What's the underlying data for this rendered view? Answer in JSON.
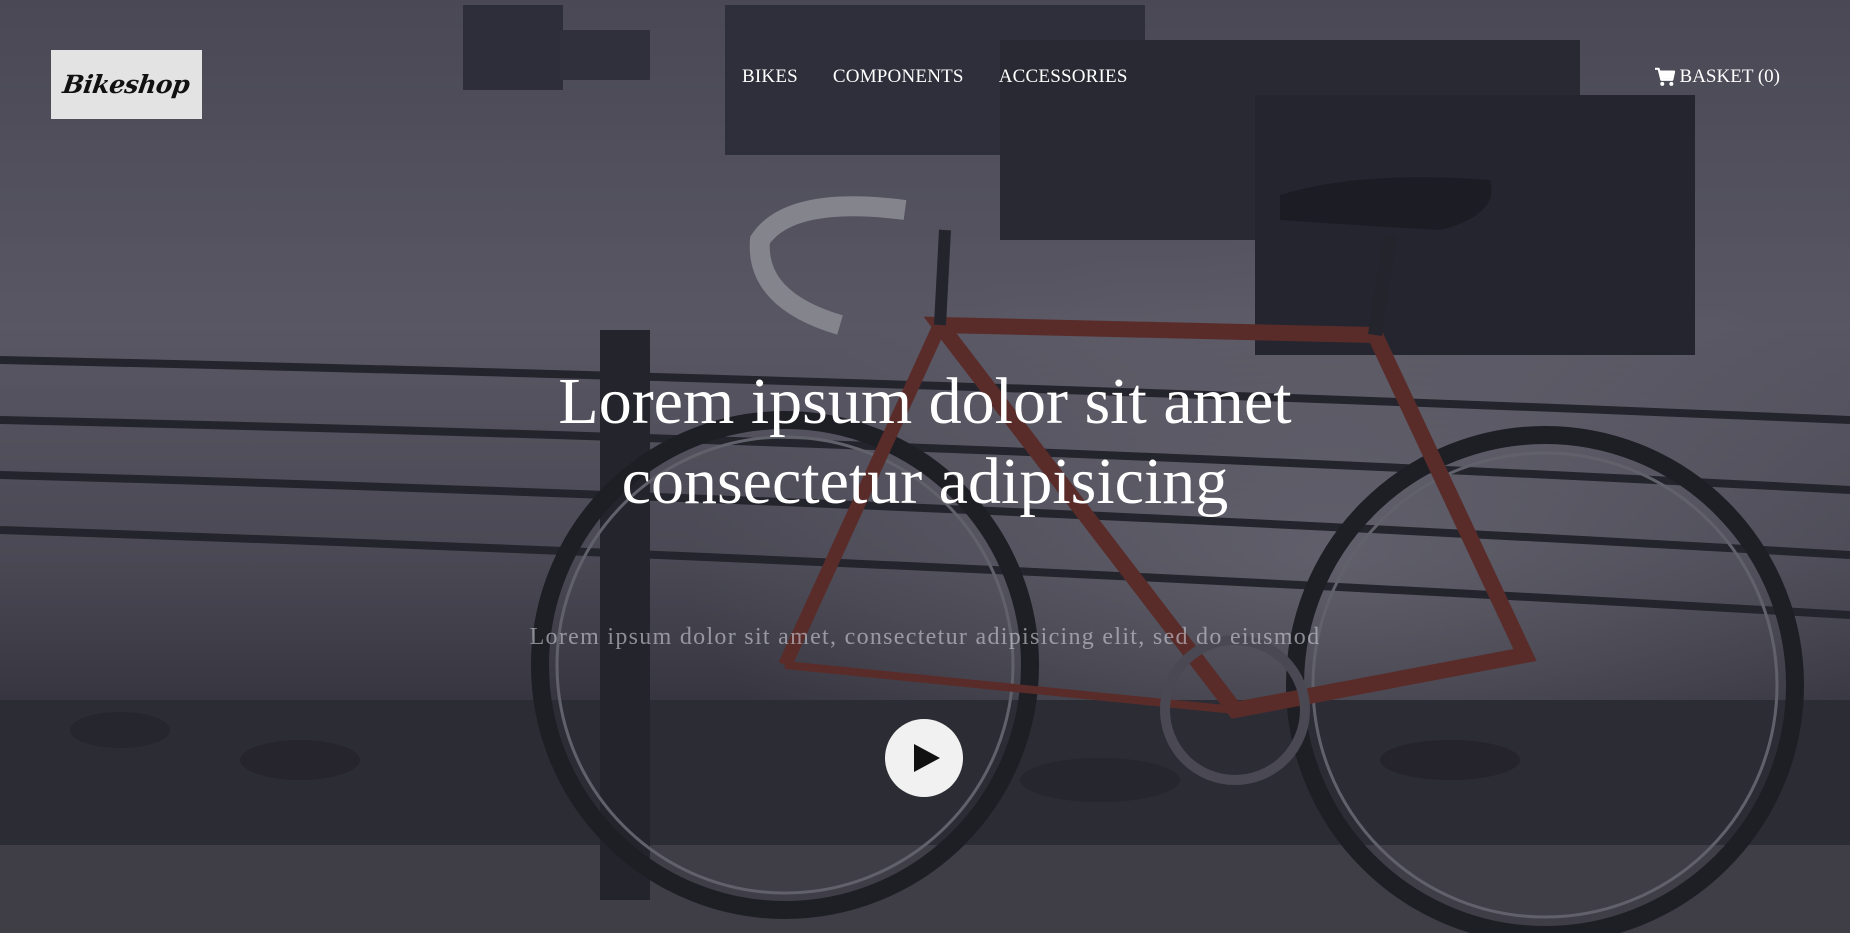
{
  "brand": {
    "logo_text": "Bikeshop"
  },
  "nav": {
    "items": [
      {
        "label": "BIKES"
      },
      {
        "label": "COMPONENTS"
      },
      {
        "label": "ACCESSORIES"
      }
    ]
  },
  "basket": {
    "label": "BASKET (0)",
    "icon": "cart-icon"
  },
  "hero": {
    "headline_line1": "Lorem ipsum dolor sit amet",
    "headline_line2": "consectetur adipisicing",
    "subtitle": "Lorem ipsum dolor sit amet, consectetur adipisicing elit, sed do eiusmod",
    "play_icon": "play-icon",
    "background_image": "bicycle-by-waterfront"
  },
  "colors": {
    "overlay": "#1c1c28",
    "logo_bg": "#e3e3e3",
    "text": "#ffffff",
    "bike_frame": "#8a3a2c"
  }
}
